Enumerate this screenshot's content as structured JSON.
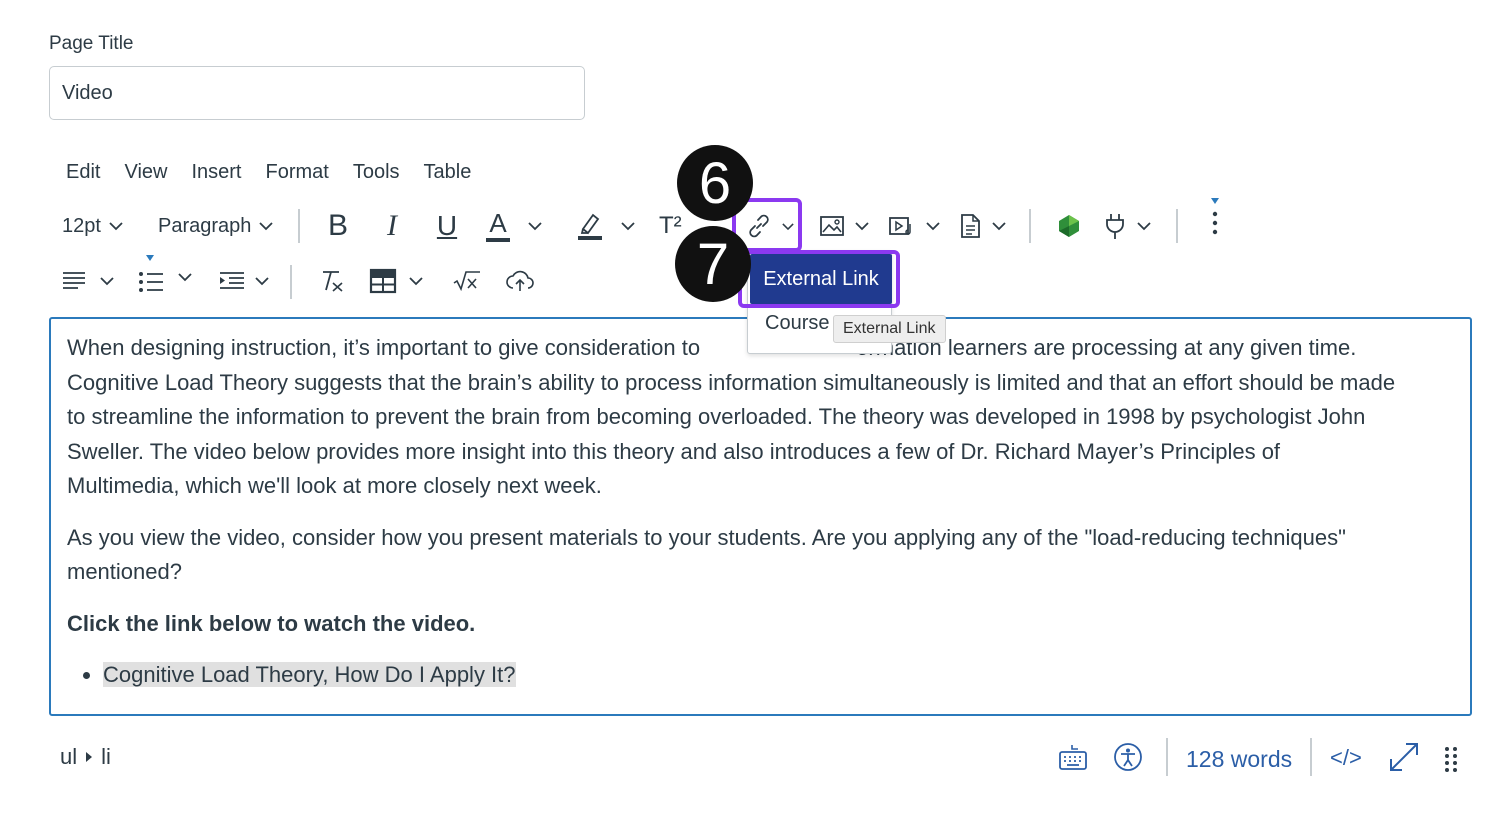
{
  "page_title": {
    "label": "Page Title",
    "value": "Video"
  },
  "menubar": {
    "items": [
      "Edit",
      "View",
      "Insert",
      "Format",
      "Tools",
      "Table"
    ]
  },
  "toolbar": {
    "font_size": "12pt",
    "block_format": "Paragraph",
    "bold_icon_text": "B",
    "italic_icon_text": "I",
    "underline_icon_text": "U",
    "text_color_icon_text": "A",
    "superscript_icon_text": "T²"
  },
  "annotations": {
    "badge_6": "6",
    "badge_7": "7"
  },
  "link_menu": {
    "external_link": "External Link",
    "course_link": "Course",
    "tooltip": "External Link"
  },
  "editor": {
    "paragraph_1_a": "When designing instruction, it’s important to give consideration to",
    "paragraph_1_b": "ormation learners are processing at any given time. Cognitive Load Theory suggests that the brain’s ability to process information simultaneously is limited and that an effort should be made to streamline the information to prevent the brain from becoming overloaded. The theory was developed in 1998 by psychologist John Sweller. The video below provides more insight into this theory and also introduces a few of Dr. Richard Mayer’s Principles of Multimedia, which we'll look at more closely next week.",
    "paragraph_2": "As you view the video, consider how you present materials to your students. Are you applying any of the \"load-reducing techniques\" mentioned?",
    "paragraph_3": "Click the link below to watch the video.",
    "list_item_1": "Cognitive Load Theory, How Do I Apply It?"
  },
  "statusbar": {
    "path_ul": "ul",
    "path_li": "li",
    "word_count": "128 words",
    "html_toggle": "</>"
  },
  "colors": {
    "accent_purple": "#8b39f0",
    "menu_highlight": "#203a8f",
    "editor_border": "#2b7abc",
    "link_blue": "#2b5ea7"
  }
}
